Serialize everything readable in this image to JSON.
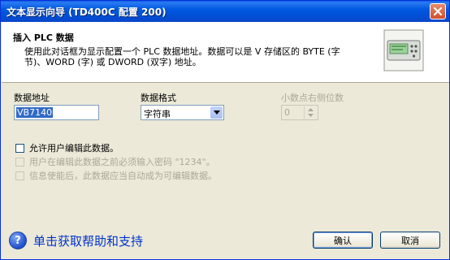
{
  "window": {
    "title": "文本显示向导 (TD400C 配置 200)",
    "close_icon": "close-icon"
  },
  "header": {
    "title": "插入 PLC 数据",
    "description_line1": "使用此对话框为显示配置一个 PLC 数据地址。数据可以是 V 存储区的 BYTE (字",
    "description_line2": "节)、WORD (字) 或 DWORD (双字) 地址。",
    "icon": "td400c-device-icon"
  },
  "fields": {
    "address_label": "数据地址",
    "address_value": "VB7140",
    "format_label": "数据格式",
    "format_value": "字符串",
    "decimals_label": "小数点右侧位数",
    "decimals_value": "0"
  },
  "options": {
    "allow_edit": "允许用户编辑此数据。",
    "require_password": "用户在编辑此数据之前必须输入密码 \"1234\"。",
    "info_enable": "信息使能后，此数据应当自动成为可编辑数据。"
  },
  "footer": {
    "help_text": "单击获取帮助和支持",
    "ok_label": "确认",
    "cancel_label": "取消"
  }
}
